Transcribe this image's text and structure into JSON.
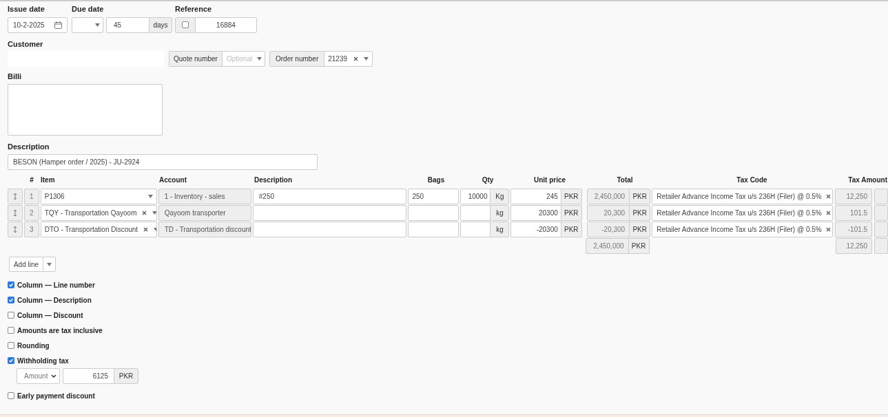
{
  "issue_date": {
    "label": "Issue date",
    "value": "10-2-2025"
  },
  "due_date": {
    "label": "Due date",
    "days": "45",
    "unit": "days"
  },
  "reference": {
    "label": "Reference",
    "checked": false,
    "value": "16884"
  },
  "customer": {
    "label": "Customer"
  },
  "quote_number": {
    "label": "Quote number",
    "placeholder": "Optional"
  },
  "order_number": {
    "label": "Order number",
    "value": "21239"
  },
  "billing_address": {
    "label": "Billi"
  },
  "description": {
    "label": "Description",
    "value": "BESON (Hamper order / 2025) - JU-2924"
  },
  "table": {
    "columns": [
      "#",
      "Item",
      "Account",
      "Description",
      "Bags",
      "Qty",
      "Unit price",
      "Total",
      "Tax Code",
      "Tax Amount"
    ],
    "rows": [
      {
        "line": "1",
        "item": "P1306",
        "clearable": false,
        "account": "1 - Inventory - sales",
        "description": "#250",
        "bags": "250",
        "qty": "10000",
        "unit": "Kg",
        "unit_price": "245",
        "currency": "PKR",
        "total": "2,450,000",
        "total_currency": "PKR",
        "tax_code": "Retailer Advance Income Tax u/s 236H (Filer) @ 0.5%",
        "tax_amount": "12,250"
      },
      {
        "line": "2",
        "item": "TQY - Transportation Qayoom",
        "clearable": true,
        "account": "Qayoom transporter",
        "description": "",
        "bags": "",
        "qty": "",
        "unit": "kg",
        "unit_price": "20300",
        "currency": "PKR",
        "total": "20,300",
        "total_currency": "PKR",
        "tax_code": "Retailer Advance Income Tax u/s 236H (Filer) @ 0.5%",
        "tax_amount": "101.5"
      },
      {
        "line": "3",
        "item": "DTO - Transportation Discount",
        "clearable": true,
        "account": "TD - Transportation discount",
        "description": "",
        "bags": "",
        "qty": "",
        "unit": "kg",
        "unit_price": "-20300",
        "currency": "PKR",
        "total": "-20,300",
        "total_currency": "PKR",
        "tax_code": "Retailer Advance Income Tax u/s 236H (Filer) @ 0.5%",
        "tax_amount": "-101.5"
      }
    ],
    "totals": {
      "total": "2,450,000",
      "currency": "PKR",
      "tax_amount": "12,250"
    }
  },
  "add_line": {
    "label": "Add line"
  },
  "options": [
    {
      "label": "Column — Line number",
      "checked": true
    },
    {
      "label": "Column — Description",
      "checked": true
    },
    {
      "label": "Column — Discount",
      "checked": false
    },
    {
      "label": "Amounts are tax inclusive",
      "checked": false
    },
    {
      "label": "Rounding",
      "checked": false
    },
    {
      "label": "Withholding tax",
      "checked": true,
      "mode": "Amount",
      "amount": "6125",
      "currency": "PKR"
    },
    {
      "label": "Early payment discount",
      "checked": false
    }
  ]
}
